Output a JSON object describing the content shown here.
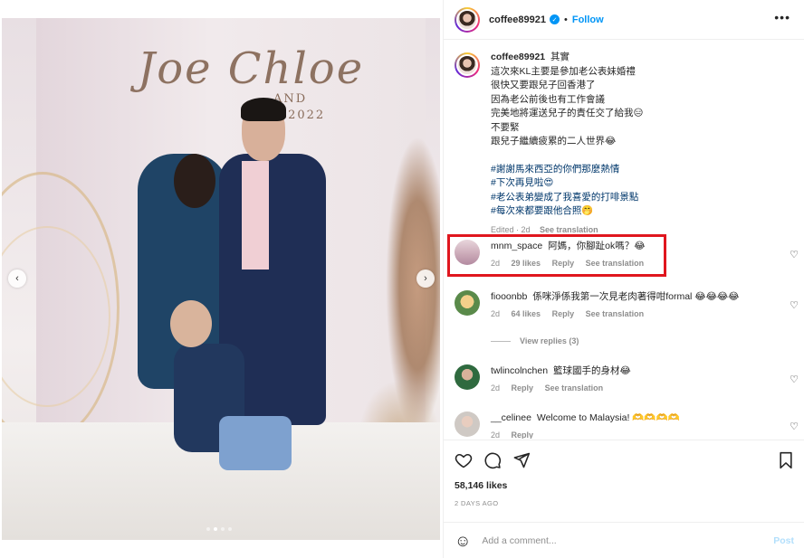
{
  "header": {
    "username": "coffee89921",
    "verified_glyph": "✓",
    "separator": "•",
    "follow_label": "Follow",
    "more_label": "•••"
  },
  "caption": {
    "username": "coffee89921",
    "lines": [
      "其實",
      "這次來KL主要是參加老公表妹婚禮",
      "很快又要跟兒子回香港了",
      "因為老公前後也有工作會議",
      "完美地將運送兒子的責任交了給我😑",
      "不要緊",
      "跟兒子繼續疲累的二人世界😂"
    ],
    "hashtags": [
      "#謝謝馬來西亞的你們那麼熱情",
      "#下次再見啦😍",
      "#老公表弟變成了我喜愛的打啡景點",
      "#每次來都要跟他合照🤭"
    ],
    "meta_edited": "Edited · 2d",
    "meta_translation": "See translation"
  },
  "comments": [
    {
      "username": "mnm_space",
      "text": "阿媽，你腳趾ok嗎？😂",
      "time": "2d",
      "likes": "29 likes",
      "reply": "Reply",
      "translation": "See translation"
    },
    {
      "username": "fiooonbb",
      "text": "係咪淨係我第一次見老肉著得咁formal 😂😂😂😂",
      "time": "2d",
      "likes": "64 likes",
      "reply": "Reply",
      "translation": "See translation"
    },
    {
      "username": "twlincolnchen",
      "text": "籃球國手的身材😂",
      "time": "2d",
      "reply": "Reply",
      "translation": "See translation"
    },
    {
      "username": "__celinee",
      "text": "Welcome to Malaysia! 🫶🫶🫶🫶",
      "time": "2d",
      "reply": "Reply"
    }
  ],
  "view_replies": "View replies (3)",
  "likes_count": "58,146 likes",
  "time_ago": "2 DAYS AGO",
  "add_comment": {
    "placeholder": "Add a comment...",
    "post_label": "Post"
  },
  "nav": {
    "prev": "‹",
    "next": "›"
  },
  "photo_sign": {
    "script": "Joe Chloe",
    "and": "AND",
    "date": "C   2022"
  },
  "icons": {
    "heart": "♡",
    "emoji": "☺"
  },
  "colors": {
    "accent": "#0095f6",
    "highlight": "#e0161e",
    "tag": "#00376b"
  }
}
